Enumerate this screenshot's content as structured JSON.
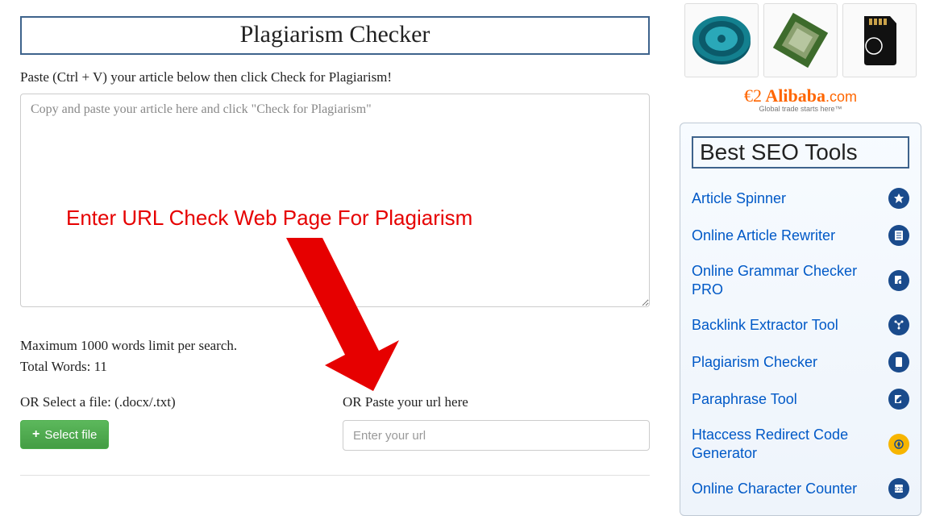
{
  "page": {
    "title": "Plagiarism Checker",
    "instruction": "Paste (Ctrl + V) your article below then click Check for Plagiarism!",
    "textarea_placeholder": "Copy and paste your article here and click \"Check for Plagiarism\"",
    "overlay_annotation": "Enter URL Check Web Page For Plagiarism",
    "max_limit": "Maximum 1000 words limit per search.",
    "total_words": "Total Words: 11",
    "file_label": "OR Select a file: (.docx/.txt)",
    "select_file_button": "Select file",
    "url_label": "OR Paste your url here",
    "url_placeholder": "Enter your url"
  },
  "ad": {
    "brand": "Alibaba",
    "suffix": ".com",
    "tagline": "Global trade starts here™"
  },
  "sidebar": {
    "title": "Best SEO Tools",
    "tools": [
      {
        "label": "Article Spinner"
      },
      {
        "label": "Online Article Rewriter"
      },
      {
        "label": "Online Grammar Checker PRO"
      },
      {
        "label": "Backlink Extractor Tool"
      },
      {
        "label": "Plagiarism Checker"
      },
      {
        "label": "Paraphrase Tool"
      },
      {
        "label": "Htaccess Redirect Code Generator"
      },
      {
        "label": "Online Character Counter"
      }
    ]
  }
}
